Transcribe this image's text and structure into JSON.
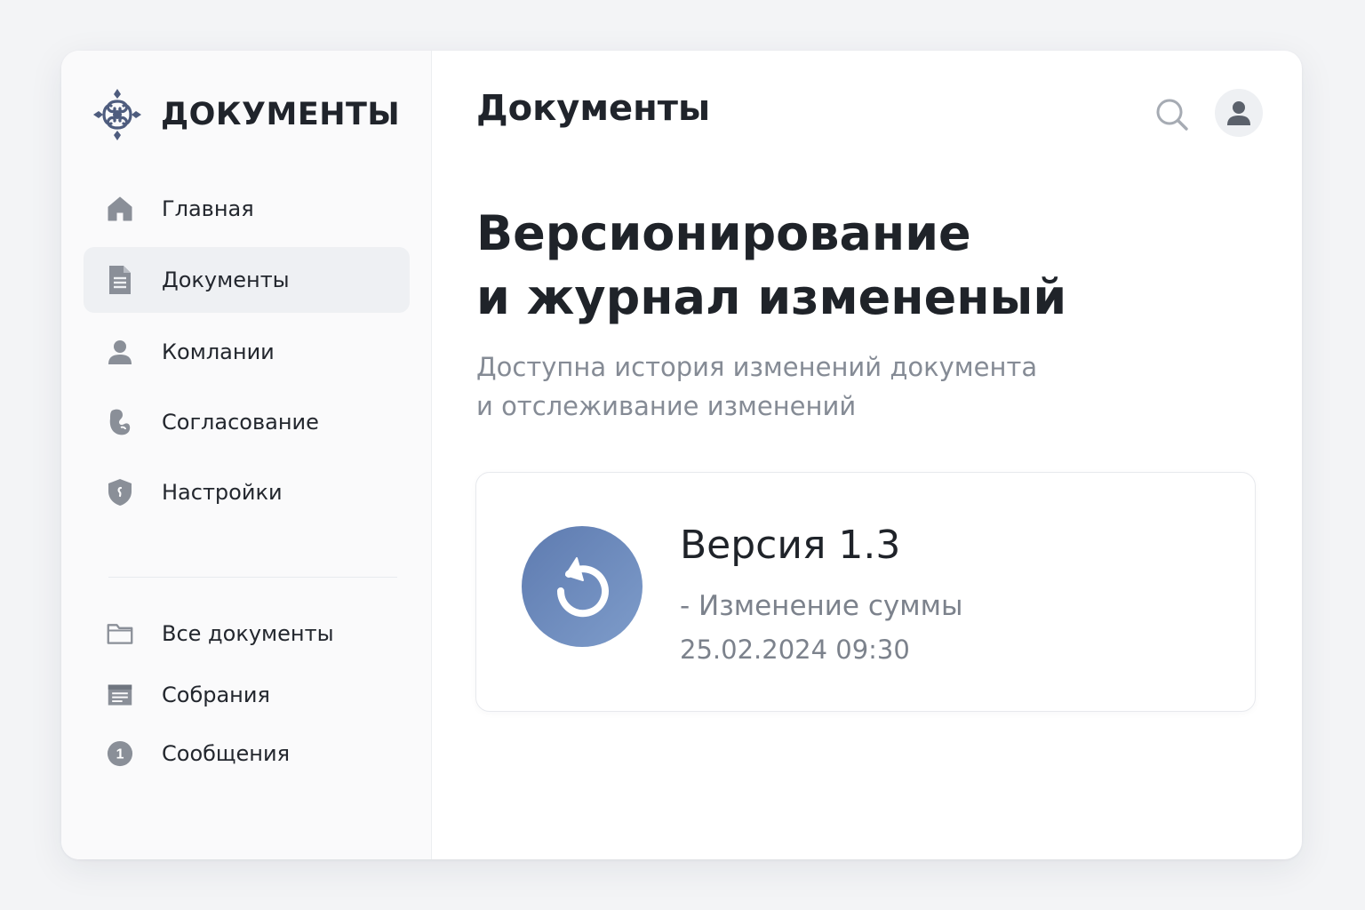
{
  "brand": {
    "title": "ДОКУМЕНТЫ",
    "logo_icon": "ornament-logo-icon",
    "accent_color": "#4e5c7e"
  },
  "sidebar": {
    "items": [
      {
        "label": "Главная",
        "icon": "home-icon",
        "active": false
      },
      {
        "label": "Документы",
        "icon": "document-icon",
        "active": true
      },
      {
        "label": "Комлании",
        "icon": "user-icon",
        "active": false
      },
      {
        "label": "Согласование",
        "icon": "approval-icon",
        "active": false
      },
      {
        "label": "Настройки",
        "icon": "shield-icon",
        "active": false
      }
    ],
    "secondary_items": [
      {
        "label": "Все документы",
        "icon": "folder-icon"
      },
      {
        "label": "Собрания",
        "icon": "meetings-icon"
      },
      {
        "label": "Сообщения",
        "icon": "message-badge-icon",
        "badge": "1"
      }
    ]
  },
  "header": {
    "title": "Документы",
    "search_icon": "search-icon",
    "avatar_icon": "user-avatar-icon"
  },
  "main": {
    "title_line1": "Версионирование",
    "title_line2": "и журнал измененый",
    "subtitle_line1": "Доступна история изменений документа",
    "subtitle_line2": "и отслеживание изменений",
    "version_card": {
      "icon": "restore-icon",
      "title": "Версия 1.3",
      "change": "- Изменение суммы",
      "date": "25.02.2024 09:30",
      "badge_color": "#6a87bb"
    }
  },
  "colors": {
    "background": "#f3f4f6",
    "sidebar_bg": "#fafafb",
    "active_item_bg": "#eef0f3",
    "icon_gray": "#8a8f98",
    "text_dark": "#1f2329",
    "text_muted": "#858b95"
  }
}
